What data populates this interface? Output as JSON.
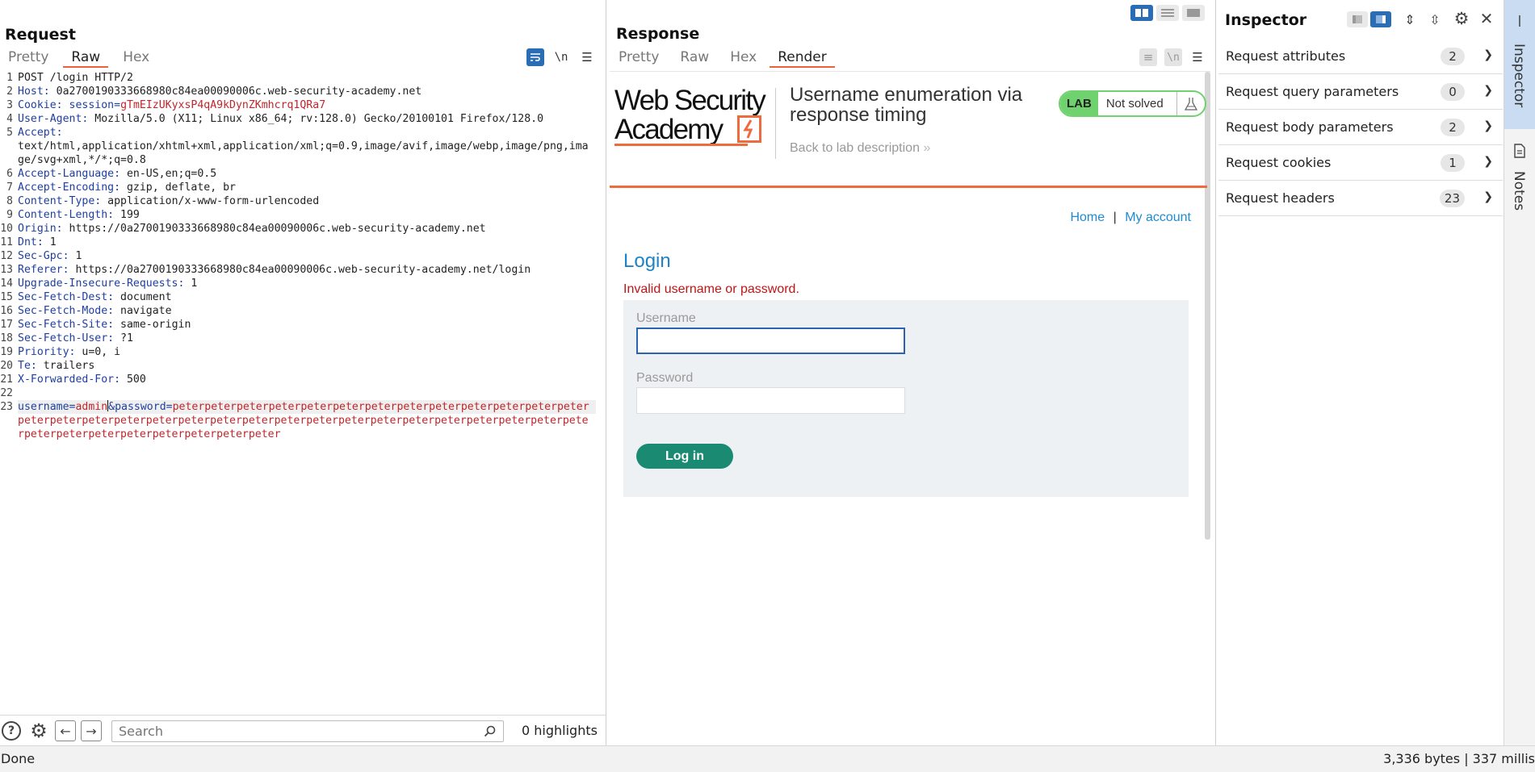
{
  "request": {
    "title": "Request",
    "tabs": [
      "Pretty",
      "Raw",
      "Hex"
    ],
    "active_tab": "Raw",
    "lines": [
      {
        "n": "1",
        "key": "",
        "val": "POST /login HTTP/2"
      },
      {
        "n": "2",
        "key": "Host",
        "val": "0a2700190333668980c84ea00090006c.web-security-academy.net"
      },
      {
        "n": "3",
        "key": "Cookie",
        "val": "session=",
        "cookie_val": "gTmEIzUKyxsP4qA9kDynZKmhcrq1QRa7"
      },
      {
        "n": "4",
        "key": "User-Agent",
        "val": "Mozilla/5.0 (X11; Linux x86_64; rv:128.0) Gecko/20100101 Firefox/128.0"
      },
      {
        "n": "5",
        "key": "Accept",
        "val": "text/html,application/xhtml+xml,application/xml;q=0.9,image/avif,image/webp,image/png,image/svg+xml,*/*;q=0.8"
      },
      {
        "n": "6",
        "key": "Accept-Language",
        "val": "en-US,en;q=0.5"
      },
      {
        "n": "7",
        "key": "Accept-Encoding",
        "val": "gzip, deflate, br"
      },
      {
        "n": "8",
        "key": "Content-Type",
        "val": "application/x-www-form-urlencoded"
      },
      {
        "n": "9",
        "key": "Content-Length",
        "val": "199"
      },
      {
        "n": "10",
        "key": "Origin",
        "val": "https://0a2700190333668980c84ea00090006c.web-security-academy.net"
      },
      {
        "n": "11",
        "key": "Dnt",
        "val": "1"
      },
      {
        "n": "12",
        "key": "Sec-Gpc",
        "val": "1"
      },
      {
        "n": "13",
        "key": "Referer",
        "val": "https://0a2700190333668980c84ea00090006c.web-security-academy.net/login"
      },
      {
        "n": "14",
        "key": "Upgrade-Insecure-Requests",
        "val": "1"
      },
      {
        "n": "15",
        "key": "Sec-Fetch-Dest",
        "val": "document"
      },
      {
        "n": "16",
        "key": "Sec-Fetch-Mode",
        "val": "navigate"
      },
      {
        "n": "17",
        "key": "Sec-Fetch-Site",
        "val": "same-origin"
      },
      {
        "n": "18",
        "key": "Sec-Fetch-User",
        "val": "?1"
      },
      {
        "n": "19",
        "key": "Priority",
        "val": "u=0, i"
      },
      {
        "n": "20",
        "key": "Te",
        "val": "trailers"
      },
      {
        "n": "21",
        "key": "X-Forwarded-For",
        "val": "500"
      },
      {
        "n": "22",
        "key": "",
        "val": ""
      }
    ],
    "body_line": {
      "n": "23",
      "k1": "username=",
      "v1": "admin",
      "k2": "&password=",
      "v2": "peterpeterpeterpeterpeterpeterpeterpeterpeterpeterpeterpeterpeterpeterpeterpeterpeterpeterpeterpeterpeterpeterpeterpeterpeterpeterpeterpeterpeterpeterpeterpeterpeterpeterpeterpeterpeterpeterpeter"
    },
    "search_placeholder": "Search",
    "highlights": "0 highlights"
  },
  "response": {
    "title": "Response",
    "tabs": [
      "Pretty",
      "Raw",
      "Hex",
      "Render"
    ],
    "active_tab": "Render",
    "page": {
      "logo_line1": "Web Security",
      "logo_line2": "Academy",
      "lab_title": "Username enumeration via response timing",
      "back_link": "Back to lab description",
      "lab_badge": "LAB",
      "lab_status": "Not solved",
      "nav_home": "Home",
      "nav_sep": "|",
      "nav_account": "My account",
      "heading": "Login",
      "error": "Invalid username or password.",
      "username_label": "Username",
      "password_label": "Password",
      "login_button": "Log in"
    }
  },
  "inspector": {
    "title": "Inspector",
    "sections": [
      {
        "label": "Request attributes",
        "count": "2"
      },
      {
        "label": "Request query parameters",
        "count": "0"
      },
      {
        "label": "Request body parameters",
        "count": "2"
      },
      {
        "label": "Request cookies",
        "count": "1"
      },
      {
        "label": "Request headers",
        "count": "23"
      }
    ]
  },
  "side_tabs": [
    "Inspector",
    "Notes"
  ],
  "status": {
    "left": "Done",
    "right": "3,336 bytes | 337 millis"
  },
  "colors": {
    "accent_blue": "#2a6db5",
    "tab_underline": "#e8623c",
    "header_key": "#1f3fa0",
    "red_value": "#c0262b",
    "lab_green": "#70d16f",
    "login_button": "#1a8b72"
  }
}
